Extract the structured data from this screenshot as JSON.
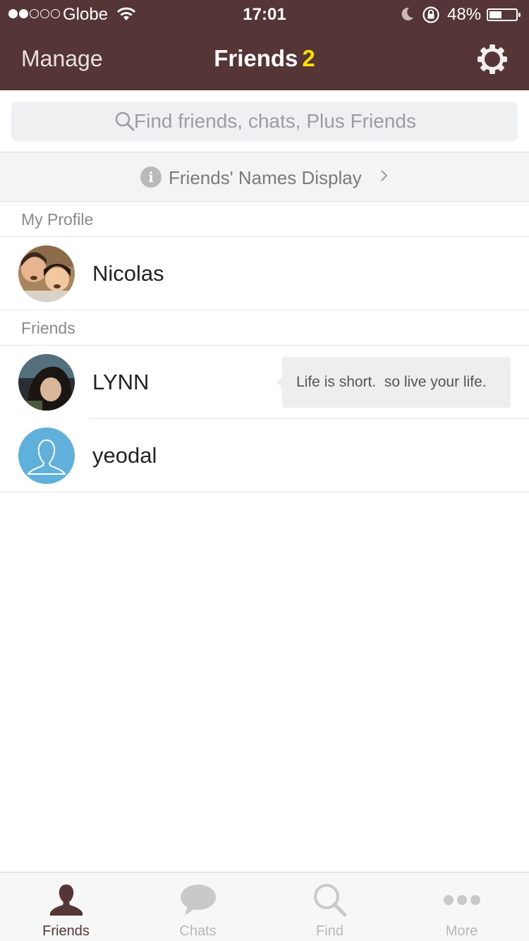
{
  "status_bar": {
    "carrier": "Globe",
    "time": "17:01",
    "battery_percent": "48%",
    "battery_level": 0.48,
    "signal_bars_filled": 2,
    "signal_bars_total": 5
  },
  "nav": {
    "left_label": "Manage",
    "title": "Friends",
    "count": "2",
    "settings_icon": "gear-icon"
  },
  "search": {
    "placeholder": "Find friends, chats, Plus Friends"
  },
  "notice": {
    "text": "Friends' Names Display"
  },
  "my_profile": {
    "header": "My Profile",
    "name": "Nicolas"
  },
  "friends": {
    "header": "Friends",
    "items": [
      {
        "name": "LYNN",
        "status_message": "Life is short.  so live your life."
      },
      {
        "name": "yeodal",
        "status_message": ""
      }
    ]
  },
  "tabbar": {
    "tabs": [
      {
        "label": "Friends",
        "icon": "person-icon",
        "active": true
      },
      {
        "label": "Chats",
        "icon": "chat-bubble-icon",
        "active": false
      },
      {
        "label": "Find",
        "icon": "search-icon",
        "active": false
      },
      {
        "label": "More",
        "icon": "more-icon",
        "active": false
      }
    ]
  },
  "colors": {
    "header_bg": "#563536",
    "count_accent": "#ffe100",
    "default_avatar_bg": "#5fb0da"
  }
}
